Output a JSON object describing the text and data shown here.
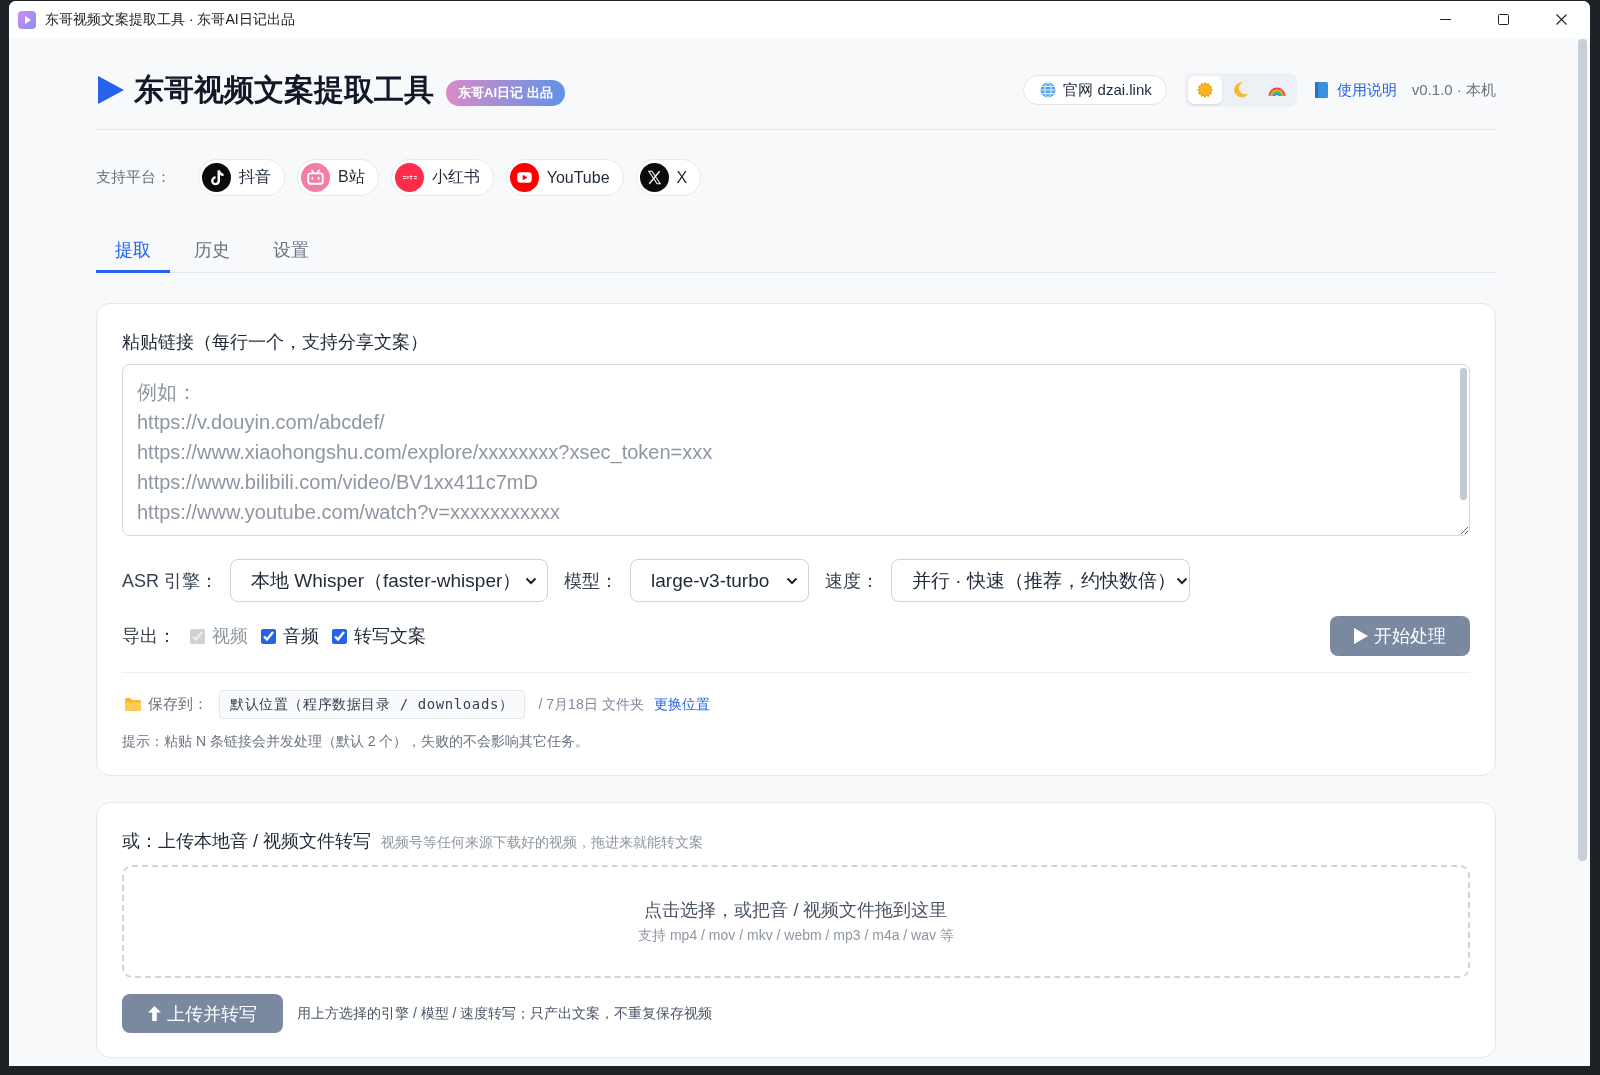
{
  "window": {
    "title": "东哥视频文案提取工具 · 东哥AI日记出品"
  },
  "header": {
    "title": "东哥视频文案提取工具",
    "badge": "东哥AI日记 出品",
    "site_link": "官网 dzai.link",
    "themes": [
      {
        "kind": "light",
        "selected": true
      },
      {
        "kind": "dark",
        "selected": false
      },
      {
        "kind": "rainbow",
        "selected": false
      }
    ],
    "help_link": "使用说明",
    "version": "v0.1.0 · 本机"
  },
  "platforms": {
    "label": "支持平台：",
    "items": [
      {
        "kind": "douyin",
        "label": "抖音"
      },
      {
        "kind": "bilibili",
        "label": "B站"
      },
      {
        "kind": "xiaohongshu",
        "label": "小红书"
      },
      {
        "kind": "youtube",
        "label": "YouTube"
      },
      {
        "kind": "x",
        "label": "X"
      }
    ]
  },
  "tabs": [
    {
      "label": "提取",
      "selected": true
    },
    {
      "label": "历史",
      "selected": false
    },
    {
      "label": "设置",
      "selected": false
    }
  ],
  "links_card": {
    "label": "粘贴链接（每行一个，支持分享文案）",
    "placeholder": "例如：\nhttps://v.douyin.com/abcdef/\nhttps://www.xiaohongshu.com/explore/xxxxxxxx?xsec_token=xxx\nhttps://www.bilibili.com/video/BV1xx411c7mD\nhttps://www.youtube.com/watch?v=xxxxxxxxxxx",
    "engine": {
      "label": "ASR 引擎：",
      "value": "本地 Whisper（faster-whisper）"
    },
    "model": {
      "label": "模型：",
      "value": "large-v3-turbo"
    },
    "speed": {
      "label": "速度：",
      "value": "并行 · 快速（推荐，约快数倍）"
    },
    "export": {
      "label": "导出：",
      "options": [
        {
          "label": "视频",
          "checked": true,
          "disabled": true
        },
        {
          "label": "音频",
          "checked": true,
          "disabled": false
        },
        {
          "label": "转写文案",
          "checked": true,
          "disabled": false
        }
      ]
    },
    "start_button": {
      "label": "开始处理",
      "disabled": true
    },
    "save": {
      "label": "保存到：",
      "path": "默认位置（程序数据目录 / downloads）",
      "suffix": "/ 7月18日 文件夹",
      "change_link": "更换位置"
    },
    "hint": "提示：粘贴 N 条链接会并发处理（默认 2 个），失败的不会影响其它任务。"
  },
  "upload_card": {
    "title": "或：上传本地音 / 视频文件转写",
    "subtitle": "视频号等任何来源下载好的视频，拖进来就能转文案",
    "drop_title": "点击选择，或把音 / 视频文件拖到这里",
    "drop_formats": "支持 mp4 / mov / mkv / webm / mp3 / m4a / wav 等",
    "button": {
      "label": "上传并转写",
      "disabled": true
    },
    "note": "用上方选择的引擎 / 模型 / 速度转写；只产出文案，不重复保存视频"
  }
}
